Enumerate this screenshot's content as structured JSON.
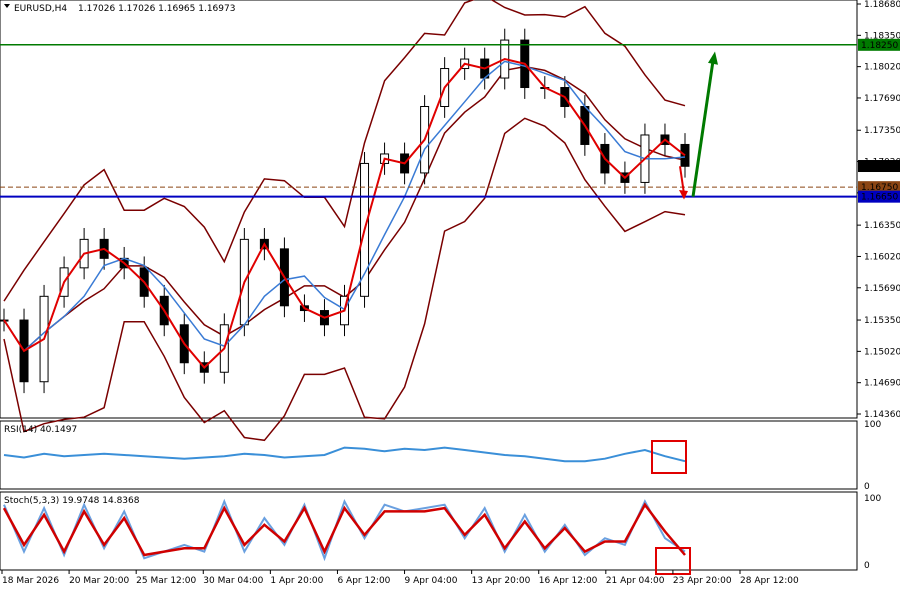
{
  "header": {
    "symbol": "EURUSD,H4",
    "ohlc": "1.17026 1.17026 1.16965 1.16973"
  },
  "price_axis": {
    "ticks": [
      "1.18680",
      "1.18350",
      "1.18020",
      "1.17690",
      "1.17350",
      "1.17020",
      "1.16690",
      "1.16350",
      "1.16020",
      "1.15690",
      "1.15350",
      "1.15020",
      "1.14690",
      "1.14360"
    ],
    "labels": [
      {
        "text": "1.18250",
        "value": 1.1825,
        "color": "#007a00"
      },
      {
        "text": "1.16973",
        "value": 1.16973,
        "color": "#000000"
      },
      {
        "text": "1.16750",
        "value": 1.1675,
        "color": "#8b4513"
      },
      {
        "text": "1.16650",
        "value": 1.1665,
        "color": "#0000c0"
      }
    ]
  },
  "rsi": {
    "title": "RSI(14) 40.1497",
    "ticks": [
      "100",
      "0"
    ]
  },
  "stoch": {
    "title": "Stoch(5,3,3) 19.9748 14.8368",
    "ticks": [
      "100",
      "0"
    ]
  },
  "time_axis": {
    "labels": [
      "18 Mar 2026",
      "20 Mar 20:00",
      "25 Mar 12:00",
      "30 Mar 04:00",
      "1 Apr 20:00",
      "6 Apr 12:00",
      "9 Apr 04:00",
      "13 Apr 20:00",
      "16 Apr 12:00",
      "21 Apr 04:00",
      "23 Apr 20:00",
      "28 Apr 12:00"
    ]
  },
  "colors": {
    "bb": "#7a0000",
    "ma_fast": "#e00000",
    "ma_slow": "#3a7bd5",
    "resistance": "#007a00",
    "support": "#0000c0",
    "dashed": "#8b4513",
    "arrow_up": "#007a00",
    "arrow_down": "#e00000",
    "rsi_line": "#3a8fd8",
    "stoch_main": "#6aa0e0",
    "stoch_signal": "#d00000",
    "highlight": "#e00000"
  },
  "chart_data": [
    {
      "type": "candlestick",
      "title": "EURUSD,H4",
      "ylim": [
        1.1436,
        1.1868
      ],
      "x": [
        "18 Mar 2026",
        "20 Mar 20:00",
        "25 Mar 12:00",
        "30 Mar 04:00",
        "1 Apr 20:00",
        "6 Apr 12:00",
        "9 Apr 04:00",
        "13 Apr 20:00",
        "16 Apr 12:00",
        "21 Apr 04:00",
        "23 Apr 20:00",
        "28 Apr 12:00"
      ],
      "close_series": [
        1.1535,
        1.147,
        1.156,
        1.159,
        1.162,
        1.16,
        1.159,
        1.156,
        1.153,
        1.149,
        1.148,
        1.153,
        1.162,
        1.161,
        1.155,
        1.1545,
        1.153,
        1.156,
        1.17,
        1.171,
        1.169,
        1.176,
        1.18,
        1.181,
        1.179,
        1.183,
        1.178,
        1.178,
        1.176,
        1.172,
        1.169,
        1.168,
        1.173,
        1.172,
        1.1697
      ],
      "levels": [
        {
          "name": "resistance",
          "value": 1.1825
        },
        {
          "name": "pending",
          "value": 1.1675
        },
        {
          "name": "support",
          "value": 1.1665
        }
      ]
    },
    {
      "type": "line",
      "title": "RSI(14) 40.1497",
      "ylim": [
        0,
        100
      ],
      "series": [
        {
          "values": [
            50,
            46,
            52,
            48,
            50,
            52,
            50,
            48,
            46,
            44,
            46,
            48,
            52,
            50,
            46,
            48,
            50,
            62,
            60,
            56,
            60,
            58,
            62,
            58,
            54,
            50,
            48,
            44,
            40,
            40,
            44,
            52,
            58,
            48,
            40
          ]
        }
      ]
    },
    {
      "type": "line",
      "title": "Stoch(5,3,3) 19.9748 14.8368",
      "ylim": [
        0,
        100
      ],
      "series": [
        {
          "values": [
            90,
            20,
            85,
            15,
            90,
            25,
            80,
            10,
            20,
            30,
            20,
            95,
            20,
            70,
            30,
            90,
            10,
            95,
            40,
            90,
            80,
            85,
            90,
            40,
            85,
            20,
            75,
            20,
            60,
            15,
            40,
            30,
            95,
            40,
            20
          ]
        },
        {
          "values": [
            85,
            30,
            75,
            20,
            80,
            30,
            70,
            15,
            20,
            25,
            25,
            85,
            30,
            60,
            35,
            85,
            20,
            85,
            45,
            80,
            80,
            80,
            85,
            45,
            75,
            25,
            65,
            25,
            55,
            20,
            35,
            35,
            90,
            50,
            15
          ]
        }
      ]
    }
  ]
}
